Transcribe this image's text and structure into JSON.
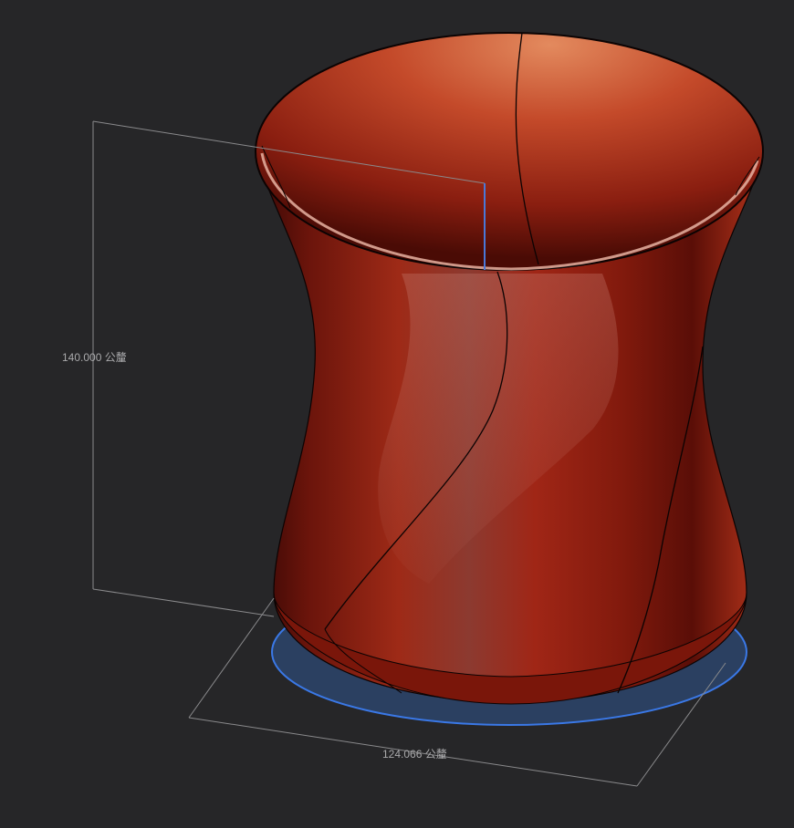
{
  "viewport": {
    "background": "#262628",
    "model": {
      "name": "vase",
      "body_color": "#9a2a16",
      "highlight_color": "#d87a52",
      "edge_color": "#0b0303",
      "selected_face_color": "#3a6fd8"
    },
    "dimensions": {
      "height_label": "140.000 公釐",
      "width_label": "124.066 公釐",
      "line_color": "#8a8a8c"
    }
  }
}
